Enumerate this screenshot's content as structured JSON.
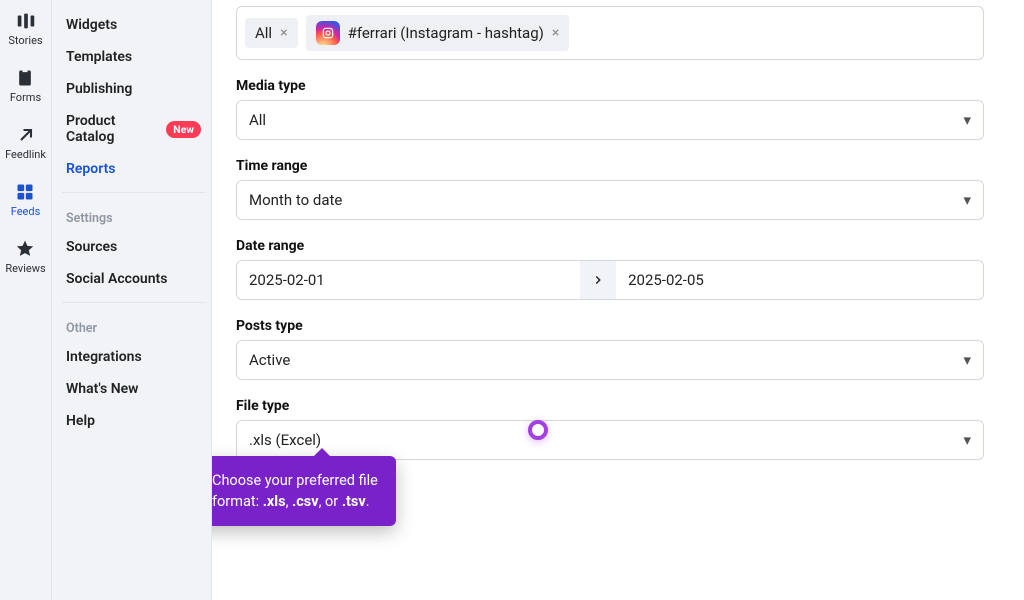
{
  "rail": [
    {
      "key": "stories",
      "label": "Stories",
      "active": false
    },
    {
      "key": "forms",
      "label": "Forms",
      "active": false
    },
    {
      "key": "feedlink",
      "label": "Feedlink",
      "active": false
    },
    {
      "key": "feeds",
      "label": "Feeds",
      "active": true
    },
    {
      "key": "reviews",
      "label": "Reviews",
      "active": false
    }
  ],
  "sidebar": {
    "main": [
      {
        "label": "Widgets"
      },
      {
        "label": "Templates"
      },
      {
        "label": "Publishing"
      },
      {
        "label": "Product Catalog",
        "badge": "New"
      },
      {
        "label": "Reports",
        "active": true
      }
    ],
    "settings_heading": "Settings",
    "settings": [
      {
        "label": "Sources"
      },
      {
        "label": "Social Accounts"
      }
    ],
    "other_heading": "Other",
    "other": [
      {
        "label": "Integrations"
      },
      {
        "label": "What's New"
      },
      {
        "label": "Help"
      }
    ]
  },
  "form": {
    "tags": {
      "all_label": "All",
      "hashtag_label": "#ferrari (Instagram - hashtag)"
    },
    "media_type": {
      "label": "Media type",
      "value": "All"
    },
    "time_range": {
      "label": "Time range",
      "value": "Month to date"
    },
    "date_range": {
      "label": "Date range",
      "from": "2025-02-01",
      "to": "2025-02-05"
    },
    "posts_type": {
      "label": "Posts type",
      "value": "Active"
    },
    "file_type": {
      "label": "File type",
      "value": ".xls (Excel)"
    }
  },
  "tooltip": {
    "line1": "Choose your preferred file",
    "line2_a": "format: ",
    "xls": ".xls",
    "sep1": ", ",
    "csv": ".csv",
    "sep2": ", or ",
    "tsv": ".tsv",
    "end": "."
  }
}
